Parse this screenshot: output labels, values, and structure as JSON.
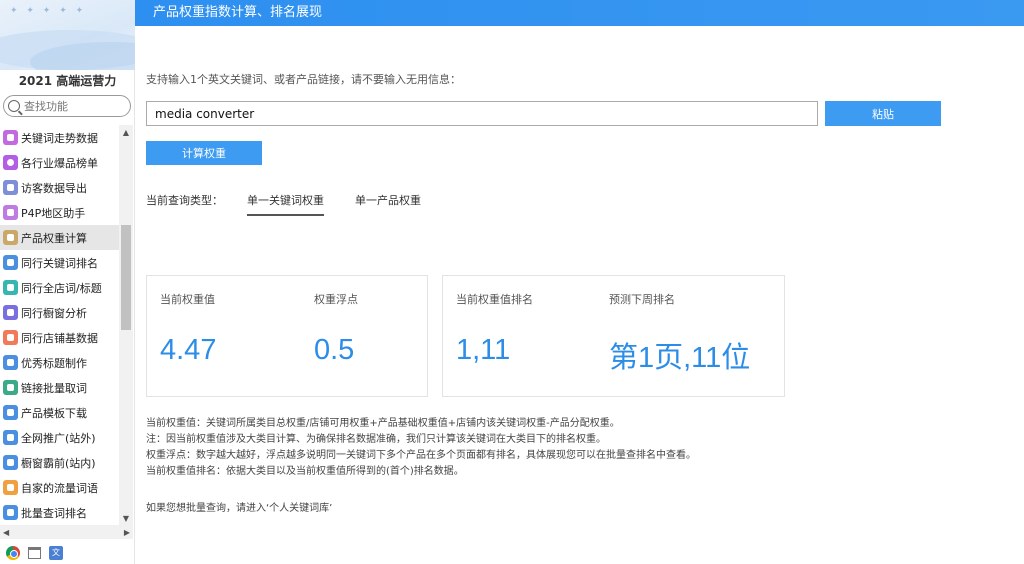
{
  "sidebar": {
    "title": "2021 高端运营力",
    "search_placeholder": "查找功能",
    "items": [
      {
        "label": "关键词走势数据",
        "icon": "mountain-icon",
        "color": "#c26be0"
      },
      {
        "label": "各行业爆品榜单",
        "icon": "circle-icon",
        "color": "#b25fe6"
      },
      {
        "label": "访客数据导出",
        "icon": "hash-icon",
        "color": "#7e8ed8"
      },
      {
        "label": "P4P地区助手",
        "icon": "mountain-icon",
        "color": "#c07be2"
      },
      {
        "label": "产品权重计算",
        "icon": "calculator-icon",
        "color": "#c9a86a"
      },
      {
        "label": "同行关键词排名",
        "icon": "chart-icon",
        "color": "#4a8fe0"
      },
      {
        "label": "同行全店词/标题",
        "icon": "list-icon",
        "color": "#35b6b0"
      },
      {
        "label": "同行橱窗分析",
        "icon": "window-icon",
        "color": "#7a6fe0"
      },
      {
        "label": "同行店铺基数据",
        "icon": "shop-icon",
        "color": "#f07a5a"
      },
      {
        "label": "优秀标题制作",
        "icon": "edit-icon",
        "color": "#4a8fe0"
      },
      {
        "label": "链接批量取词",
        "icon": "link-icon",
        "color": "#3aaa88"
      },
      {
        "label": "产品模板下载",
        "icon": "download-icon",
        "color": "#4a8fe0"
      },
      {
        "label": "全网推广(站外)",
        "icon": "grid-icon",
        "color": "#4a8fe0"
      },
      {
        "label": "橱窗霸前(站内)",
        "icon": "trophy-icon",
        "color": "#4a8fe0"
      },
      {
        "label": "自家的流量词语",
        "icon": "shield-icon",
        "color": "#f0a040"
      },
      {
        "label": "批量查词排名",
        "icon": "search-icon",
        "color": "#4a8fe0"
      }
    ],
    "active_index": 4
  },
  "header": {
    "title": "产品权重指数计算、排名展现"
  },
  "main": {
    "hint": "支持输入1个英文关键词、或者产品链接，请不要输入无用信息：",
    "keyword_value": "media converter",
    "paste_label": "粘贴",
    "calc_label": "计算权重",
    "query_type_label": "当前查询类型：",
    "tabs": [
      {
        "label": "单一关键词权重"
      },
      {
        "label": "单一产品权重"
      }
    ],
    "active_tab": 0,
    "stats": [
      {
        "label": "当前权重值",
        "value": "4.47"
      },
      {
        "label": "权重浮点",
        "value": "0.5"
      },
      {
        "label": "当前权重值排名",
        "value": "1,11"
      },
      {
        "label": "预测下周排名",
        "value": "第1页,11位"
      }
    ],
    "notes": [
      "当前权重值：关键词所属类目总权重/店铺可用权重+产品基础权重值+店铺内该关键词权重-产品分配权重。",
      "注：因当前权重值涉及大类目计算、为确保排名数据准确，我们只计算该关键词在大类目下的排名权重。",
      "权重浮点：数字越大越好，浮点越多说明同一关键词下多个产品在多个页面都有排名，具体展现您可以在批量查排名中查看。",
      "当前权重值排名：依据大类目以及当前权重值所得到的(首个)排名数据。"
    ],
    "batch_hint": "如果您想批量查询，请进入‘个人关键词库’"
  }
}
